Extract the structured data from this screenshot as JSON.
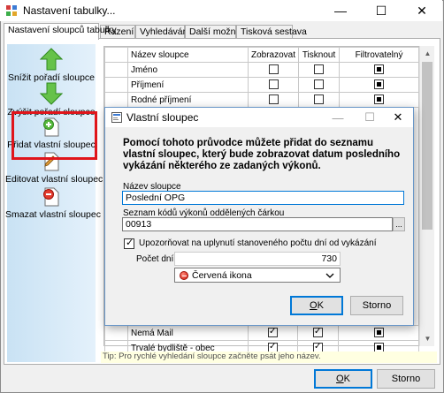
{
  "window": {
    "title": "Nastavení tabulky...",
    "controls": {
      "minimize": "—",
      "maximize": "☐",
      "close": "✕"
    }
  },
  "tabs": [
    {
      "label": "Nastavení sloupců tabulky",
      "active": true
    },
    {
      "label": "Řazení"
    },
    {
      "label": "Vyhledávání"
    },
    {
      "label": "Další možnosti"
    },
    {
      "label": "Tisková sestava"
    }
  ],
  "actions": {
    "decrease_order": "Snížit pořadí sloupce",
    "increase_order": "Zvýšit pořadí sloupce",
    "add_column": "Přidat vlastní sloupec",
    "edit_column": "Editovat vlastní sloupec",
    "delete_column": "Smazat vlastní sloupec"
  },
  "grid": {
    "headers": {
      "name": "Název sloupce",
      "show": "Zobrazovat",
      "print": "Tisknout",
      "filter": "Filtrovatelný"
    },
    "rows_top": [
      {
        "name": "Jméno"
      },
      {
        "name": "Příjmení"
      },
      {
        "name": "Rodné příjmení"
      }
    ],
    "rows_bottom": [
      {
        "name": "Nemá Mail"
      },
      {
        "name": "Trvalé bydliště - obec"
      }
    ]
  },
  "tip": "Tip: Pro rychlé vyhledání sloupce začněte psát jeho název.",
  "buttons": {
    "ok": "OK",
    "ok_key": "O",
    "ok_rest": "K",
    "cancel": "Storno"
  },
  "dialog": {
    "title": "Vlastní sloupec",
    "controls": {
      "minimize": "—",
      "maximize": "☐",
      "close": "✕"
    },
    "description": "Pomocí tohoto průvodce můžete přidat do seznamu vlastní sloupec, který bude zobrazovat datum posledního vykázání některého ze zadaných výkonů.",
    "name_label": "Název sloupce",
    "name_value": "Poslední OPG",
    "codes_label": "Seznam kódů výkonů oddělených čárkou",
    "codes_value": "00913",
    "browse_label": "...",
    "notify_label": "Upozorňovat na uplynutí stanoveného počtu dní od vykázání",
    "days_label": "Počet dní:",
    "days_value": "730",
    "icon_select": "Červená ikona",
    "ok_key": "O",
    "ok_rest": "K",
    "cancel": "Storno"
  },
  "colors": {
    "highlight": "#e0151b",
    "accent": "#0078d7",
    "tip_bg": "#ffffe1"
  }
}
